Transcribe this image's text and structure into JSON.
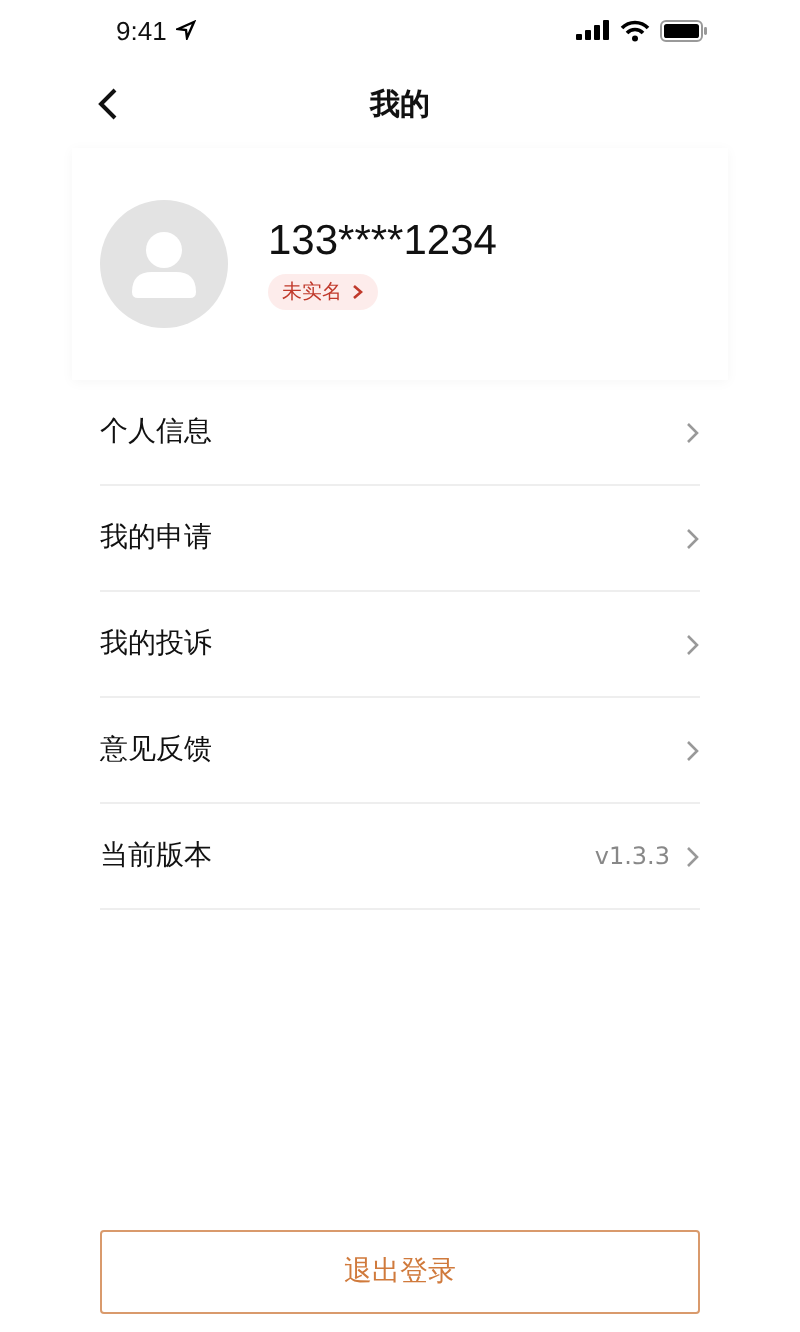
{
  "status_bar": {
    "time": "9:41"
  },
  "nav": {
    "title": "我的"
  },
  "profile": {
    "phone": "133****1234",
    "badge": "未实名"
  },
  "menu": [
    {
      "label": "个人信息"
    },
    {
      "label": "我的申请"
    },
    {
      "label": "我的投诉"
    },
    {
      "label": "意见反馈"
    },
    {
      "label": "当前版本",
      "value": "v1.3.3"
    }
  ],
  "logout_button": "退出登录"
}
